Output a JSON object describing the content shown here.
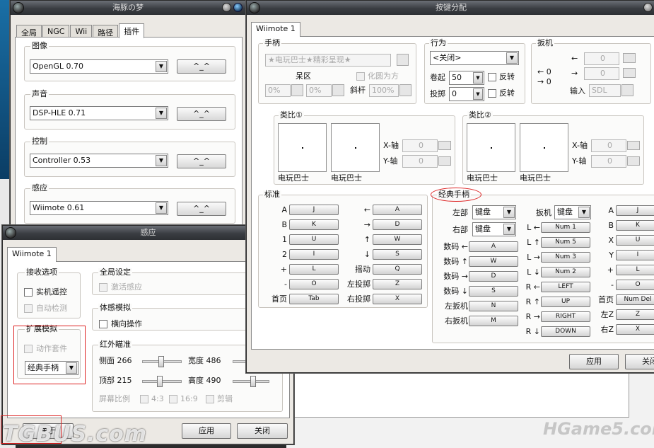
{
  "dolphin": {
    "title": "海豚の梦",
    "tabs": [
      "全局",
      "NGC",
      "Wii",
      "路径",
      "插件"
    ],
    "configure_label": "^_^",
    "groups": [
      {
        "label": "图像",
        "value": "OpenGL 0.70"
      },
      {
        "label": "声音",
        "value": "DSP-HLE 0.71"
      },
      {
        "label": "控制",
        "value": "Controller 0.53"
      },
      {
        "label": "感应",
        "value": "Wiimote 0.61"
      }
    ]
  },
  "wiimote": {
    "title": "感应",
    "tab": "Wiimote 1",
    "recv": {
      "label": "接收选项",
      "real": "实机遥控",
      "auto": "自动检测"
    },
    "ext": {
      "label": "扩展模拟",
      "motion": "动作套件",
      "value": "经典手柄"
    },
    "global": {
      "label": "全局设定",
      "activate": "激活感应"
    },
    "motion": {
      "label": "体感模拟",
      "sideways": "横向操作"
    },
    "ir": {
      "label": "红外瞄准",
      "left": "侧面 266",
      "width": "宽度 486",
      "top": "顶部 215",
      "height": "高度 490",
      "ratio": "屏幕比例",
      "r43": "4:3",
      "r169": "16:9",
      "crop": "剪辑"
    },
    "about": "关于",
    "apply": "应用",
    "close": "关闭"
  },
  "keymap": {
    "title": "按键分配",
    "tab": "Wiimote 1",
    "handle": {
      "label": "手柄",
      "device": "★电玩巴士★精彩呈现★",
      "deadzone": "呆区",
      "circle": "化圆为方",
      "dz1": "0%",
      "dz2": "0%",
      "diag": "斜杆",
      "diag_val": "100%"
    },
    "behavior": {
      "label": "行为",
      "mode": "<关闭>",
      "roll": "卷起",
      "roll_val": "50",
      "pitch": "投掷",
      "pitch_val": "0",
      "invert": "反转"
    },
    "trigger": {
      "label": "扳机",
      "left_arrow": "←",
      "right_arrow": "→",
      "v1": "0",
      "v2": "0",
      "r1": "← 0",
      "r2": "→ 0",
      "input": "输入",
      "input_val": "SDL"
    },
    "analog1": {
      "label": "类比①",
      "xaxis": "X-轴",
      "yaxis": "Y-轴",
      "v": "0",
      "cap1": "电玩巴士",
      "cap2": "电玩巴士"
    },
    "analog2": {
      "label": "类比②",
      "xaxis": "X-轴",
      "yaxis": "Y-轴",
      "v": "0",
      "cap1": "电玩巴士",
      "cap2": "电玩巴士"
    },
    "standard": {
      "label": "标准",
      "left_col": [
        {
          "k": "A",
          "v": "J"
        },
        {
          "k": "B",
          "v": "K"
        },
        {
          "k": "1",
          "v": "U"
        },
        {
          "k": "2",
          "v": "I"
        },
        {
          "k": "+",
          "v": "L"
        },
        {
          "k": "-",
          "v": "O"
        },
        {
          "k": "首页",
          "v": "Tab"
        }
      ],
      "right_col": [
        {
          "k": "←",
          "v": "A"
        },
        {
          "k": "→",
          "v": "D"
        },
        {
          "k": "↑",
          "v": "W"
        },
        {
          "k": "↓",
          "v": "S"
        },
        {
          "k": "摇动",
          "v": "Q"
        },
        {
          "k": "左投掷",
          "v": "Z"
        },
        {
          "k": "右投掷",
          "v": "X"
        }
      ]
    },
    "classic": {
      "label": "经典手柄",
      "left_part": "左部",
      "right_part": "右部",
      "trigger_part": "扳机",
      "kbd": "键盘",
      "dpad": [
        {
          "k": "数码 ←",
          "v": "A"
        },
        {
          "k": "数码 ↑",
          "v": "W"
        },
        {
          "k": "数码 →",
          "v": "D"
        },
        {
          "k": "数码 ↓",
          "v": "S"
        },
        {
          "k": "左扳机",
          "v": "N"
        },
        {
          "k": "右扳机",
          "v": "M"
        }
      ],
      "sticks": [
        {
          "k": "L ←",
          "v": "Num 1"
        },
        {
          "k": "L ↑",
          "v": "Num 5"
        },
        {
          "k": "L →",
          "v": "Num 3"
        },
        {
          "k": "L ↓",
          "v": "Num 2"
        },
        {
          "k": "R ←",
          "v": "LEFT"
        },
        {
          "k": "R ↑",
          "v": "UP"
        },
        {
          "k": "R →",
          "v": "RIGHT"
        },
        {
          "k": "R ↓",
          "v": "DOWN"
        }
      ],
      "buttons": [
        {
          "k": "A",
          "v": "J"
        },
        {
          "k": "B",
          "v": "K"
        },
        {
          "k": "X",
          "v": "U"
        },
        {
          "k": "Y",
          "v": "I"
        },
        {
          "k": "+",
          "v": "L"
        },
        {
          "k": "-",
          "v": "O"
        },
        {
          "k": "首页",
          "v": "Num Del"
        },
        {
          "k": "左Z",
          "v": "Z"
        },
        {
          "k": "右Z",
          "v": "X"
        }
      ]
    },
    "apply": "应用",
    "close": "关闭"
  },
  "watermarks": {
    "left": "TGBUS.com",
    "right": "HGame5.com"
  }
}
